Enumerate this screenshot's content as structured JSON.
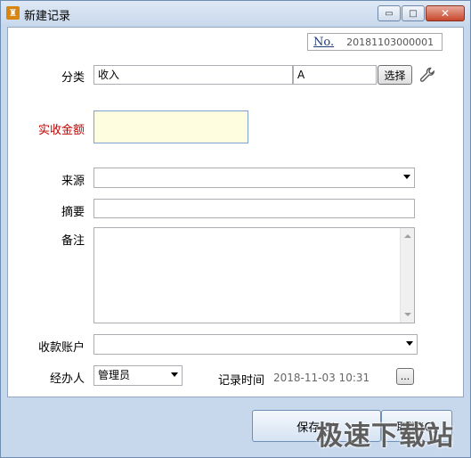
{
  "window": {
    "title": "新建记录",
    "app_icon": "app-logo-icon",
    "minimize_glyph": "▭",
    "maximize_glyph": "□",
    "close_glyph": "✕"
  },
  "record_no": {
    "label": "No.",
    "value": "20181103000001"
  },
  "category": {
    "label": "分类",
    "value": "收入",
    "sub_value": "A",
    "select_label": "选择"
  },
  "amount": {
    "label": "实收金额",
    "value": ""
  },
  "source": {
    "label": "来源",
    "value": ""
  },
  "summary": {
    "label": "摘要",
    "value": ""
  },
  "note": {
    "label": "备注",
    "value": ""
  },
  "account": {
    "label": "收款账户",
    "value": ""
  },
  "handler": {
    "label": "经办人",
    "value": "管理员"
  },
  "record_time": {
    "label": "记录时间",
    "value": "2018-11-03 10:31",
    "picker_label": "..."
  },
  "actions": {
    "save_label": "保存(S)",
    "cancel_label": "取消(C)"
  },
  "watermark": "极速下载站",
  "colors": {
    "required_label": "#c00000",
    "amount_bg": "#fffde0"
  }
}
